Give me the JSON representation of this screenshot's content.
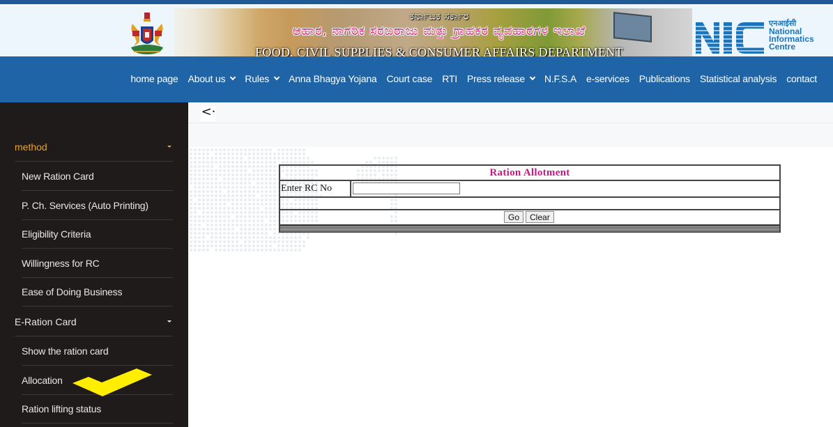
{
  "header": {
    "kannada_line1": "ಕರ್ನಾಟಕ ಸರ್ಕಾರ",
    "kannada_line2": "ಆಹಾರ, ನಾಗರಿಕ ಸರಬರಾಜು ಮತ್ತು ಗ್ರಾಹಕರ ವ್ಯವಹಾರಗಳ ಇಲಾಖೆ",
    "english_title": "FOOD, CIVIL SUPPLIES & CONSUMER AFFAIRS DEPARTMENT",
    "nic_hindi": "एनआईसी",
    "nic_line1": "National",
    "nic_line2": "Informatics",
    "nic_line3": "Centre"
  },
  "nav": {
    "items": [
      {
        "label": "home page",
        "dropdown": false
      },
      {
        "label": "About us",
        "dropdown": true
      },
      {
        "label": "Rules",
        "dropdown": true
      },
      {
        "label": "Anna Bhagya Yojana",
        "dropdown": false
      },
      {
        "label": "Court case",
        "dropdown": false
      },
      {
        "label": "RTI",
        "dropdown": false
      },
      {
        "label": "Press release",
        "dropdown": true
      },
      {
        "label": "N.F.S.A",
        "dropdown": false
      },
      {
        "label": "e-services",
        "dropdown": false
      },
      {
        "label": "Publications",
        "dropdown": false
      },
      {
        "label": "Statistical analysis",
        "dropdown": false
      },
      {
        "label": "contact",
        "dropdown": false
      }
    ]
  },
  "sidebar": {
    "groups": [
      {
        "label": "method",
        "active": true,
        "color": "#f0a21b",
        "items": [
          "New Ration Card",
          "P. Ch. Services (Auto Printing)",
          "Eligibility Criteria",
          "Willingness for RC",
          "Ease of Doing Business"
        ]
      },
      {
        "label": "E-Ration Card",
        "active": false,
        "color": "#e8e8e8",
        "items": [
          "Show the ration card",
          "Allocation",
          "Ration lifting status"
        ]
      }
    ]
  },
  "main": {
    "back_icon": "<·",
    "form": {
      "title": "Ration Allotment",
      "rc_label": "Enter RC No",
      "rc_value": "",
      "rc_placeholder": "",
      "go_label": "Go",
      "clear_label": "Clear"
    }
  },
  "colors": {
    "nav_bg": "#1f64a6",
    "sidebar_bg": "#1e1b1a",
    "active_group": "#f0a21b",
    "form_title": "#c71585",
    "annotation_check": "#ffee00"
  }
}
